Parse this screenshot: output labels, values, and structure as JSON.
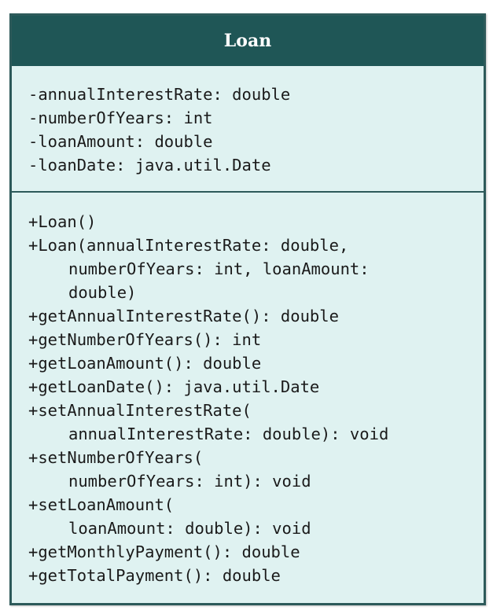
{
  "class_name": "Loan",
  "attributes": [
    "-annualInterestRate: double",
    "-numberOfYears: int",
    "-loanAmount: double",
    "-loanDate: java.util.Date"
  ],
  "operations": [
    "+Loan()",
    "+Loan(annualInterestRate: double,",
    "numberOfYears: int, loanAmount:",
    "double)",
    "+getAnnualInterestRate(): double",
    "+getNumberOfYears(): int",
    "+getLoanAmount(): double",
    "+getLoanDate(): java.util.Date",
    "+setAnnualInterestRate(",
    "annualInterestRate: double): void",
    "+setNumberOfYears(",
    "numberOfYears: int): void",
    "+setLoanAmount(",
    "loanAmount: double): void",
    "+getMonthlyPayment(): double",
    "+getTotalPayment(): double"
  ],
  "colors": {
    "header": "#1f5656",
    "body": "#dff2f1",
    "border": "#2d5a5a"
  }
}
